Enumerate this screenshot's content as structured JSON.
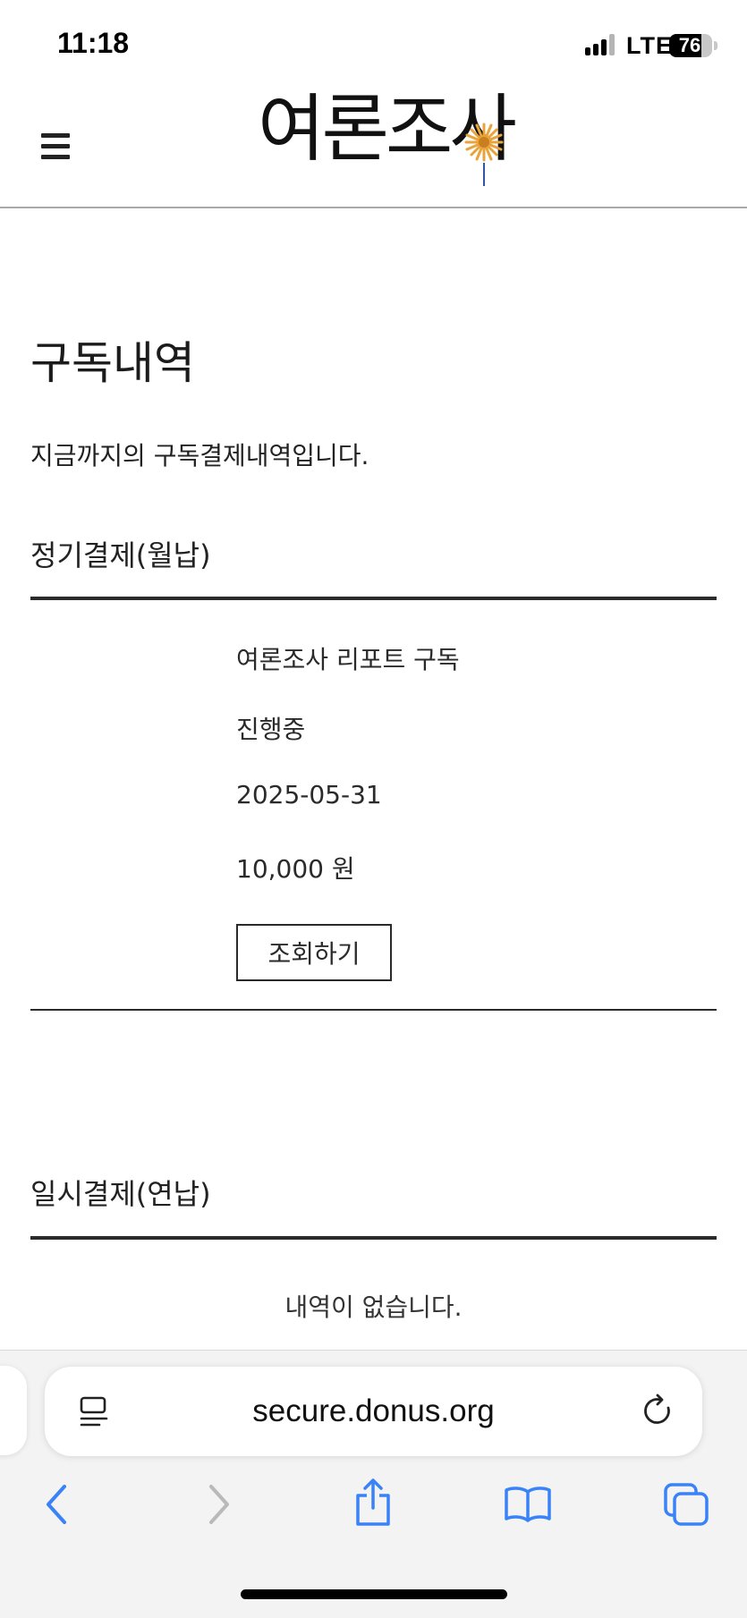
{
  "status_bar": {
    "time": "11:18",
    "network": "LTE",
    "battery": "76"
  },
  "header": {
    "menu_icon": "hamburger-menu-icon",
    "logo_text": "여론조사",
    "logo_icon": "flower-logo-icon"
  },
  "page": {
    "title": "구독내역",
    "description": "지금까지의 구독결제내역입니다."
  },
  "monthly": {
    "title": "정기결제(월납)",
    "item": {
      "name": "여론조사 리포트 구독",
      "status": "진행중",
      "date": "2025-05-31",
      "amount": "10,000 원",
      "button": "조회하기"
    }
  },
  "annual": {
    "title": "일시결제(연납)",
    "empty": "내역이 없습니다."
  },
  "browser": {
    "url": "secure.donus.org",
    "icons": [
      "reader-icon",
      "reload-icon",
      "back-icon",
      "forward-icon",
      "share-icon",
      "bookmarks-icon",
      "tabs-icon"
    ]
  },
  "colors": {
    "accent_blue": "#3a82f7",
    "logo_flower": "#e8a33a"
  }
}
